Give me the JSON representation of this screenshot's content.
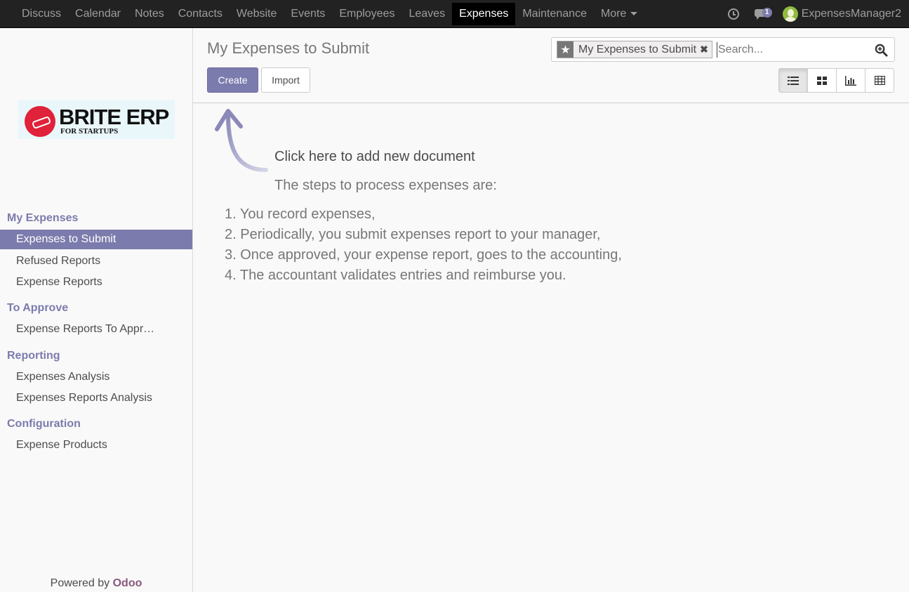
{
  "topnav": {
    "items": [
      "Discuss",
      "Calendar",
      "Notes",
      "Contacts",
      "Website",
      "Events",
      "Employees",
      "Leaves",
      "Expenses",
      "Maintenance",
      "More"
    ],
    "active": "Expenses",
    "messages_badge": "1",
    "username": "ExpensesManager2"
  },
  "sidebar": {
    "logo": {
      "title": "BRITE ERP",
      "subtitle": "FOR STARTUPS"
    },
    "sections": [
      {
        "heading": "My Expenses",
        "items": [
          "Expenses to Submit",
          "Refused Reports",
          "Expense Reports"
        ]
      },
      {
        "heading": "To Approve",
        "items": [
          "Expense Reports To Appr…"
        ]
      },
      {
        "heading": "Reporting",
        "items": [
          "Expenses Analysis",
          "Expenses Reports Analysis"
        ]
      },
      {
        "heading": "Configuration",
        "items": [
          "Expense Products"
        ]
      }
    ],
    "active_item": "Expenses to Submit",
    "powered_by": "Powered by",
    "powered_brand": "Odoo"
  },
  "control_panel": {
    "title": "My Expenses to Submit",
    "create_label": "Create",
    "import_label": "Import",
    "search": {
      "facet": "My Expenses to Submit",
      "placeholder": "Search..."
    },
    "views": [
      "list-icon",
      "kanban-icon",
      "graph-icon",
      "pivot-icon"
    ],
    "active_view": "list"
  },
  "help": {
    "title": "Click here to add new document",
    "subtitle": "The steps to process expenses are:",
    "steps": [
      "1. You record expenses,",
      "2. Periodically, you submit expenses report to your manager,",
      "3. Once approved, your expense report, goes to the accounting,",
      "4. The accountant validates entries and reimburse you."
    ]
  },
  "colors": {
    "brand": "#7c7bad",
    "topbar": "#222222",
    "odoo": "#875a7b"
  }
}
